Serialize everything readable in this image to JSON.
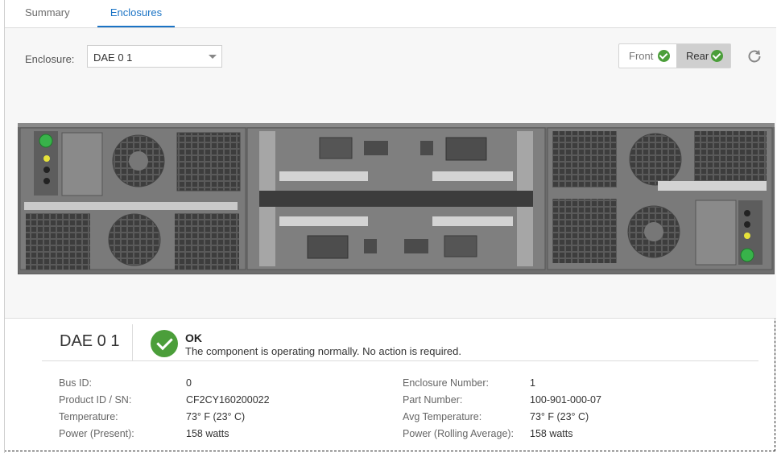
{
  "tabs": {
    "summary": "Summary",
    "enclosures": "Enclosures"
  },
  "enclosure_selector": {
    "label": "Enclosure:",
    "value": "DAE 0 1"
  },
  "view_toggle": {
    "front": "Front",
    "rear": "Rear",
    "selected": "Rear"
  },
  "detail": {
    "name": "DAE 0 1",
    "status_title": "OK",
    "status_text": "The component is operating normally. No action is required."
  },
  "properties": {
    "left": [
      {
        "label": "Bus ID:",
        "value": "0"
      },
      {
        "label": "Product ID / SN:",
        "value": "CF2CY160200022"
      },
      {
        "label": "Temperature:",
        "value": "73° F (23° C)"
      },
      {
        "label": "Power (Present):",
        "value": "158 watts"
      }
    ],
    "right": [
      {
        "label": "Enclosure Number:",
        "value": "1"
      },
      {
        "label": "Part Number:",
        "value": "100-901-000-07"
      },
      {
        "label": "Avg Temperature:",
        "value": "73° F (23° C)"
      },
      {
        "label": "Power (Rolling Average):",
        "value": "158 watts"
      }
    ]
  },
  "colors": {
    "accent": "#1a73c5",
    "ok_green": "#4b9e3a",
    "chassis": "#6b6b6b"
  }
}
